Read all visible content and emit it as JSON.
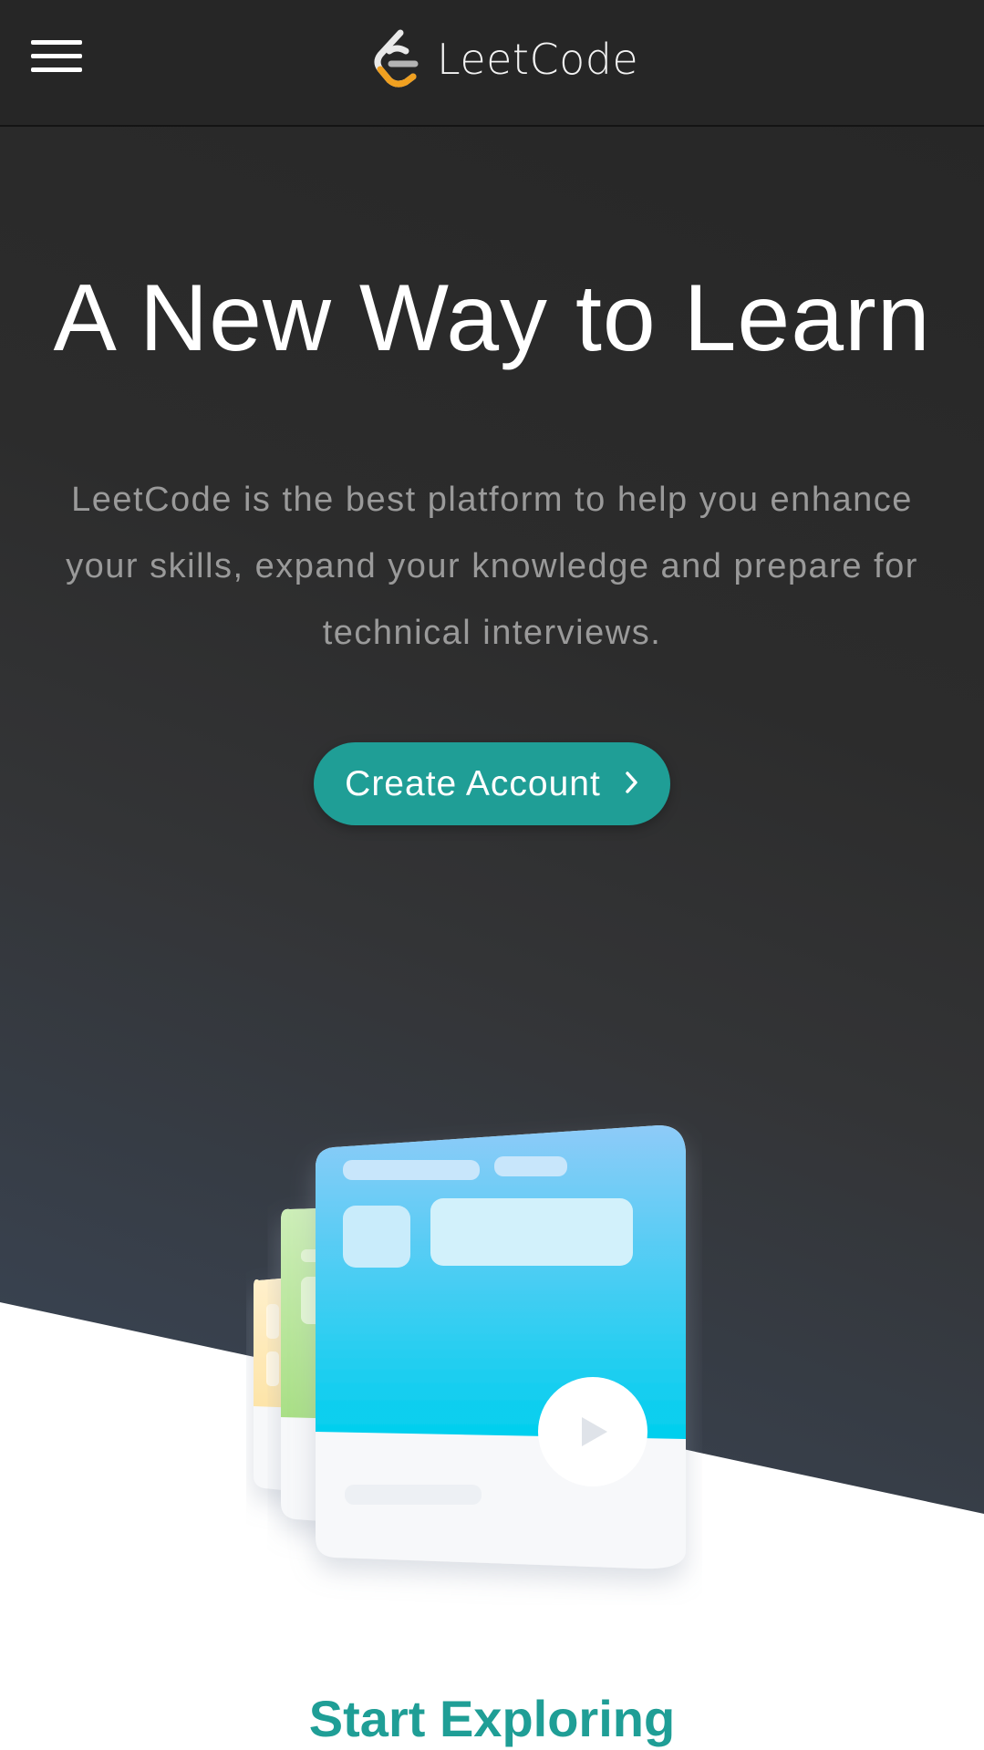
{
  "header": {
    "menu_icon": "hamburger-menu-icon",
    "logo_text": "LeetCode"
  },
  "hero": {
    "headline": "A New Way to Learn",
    "description": "LeetCode is the best platform to help you enhance your skills, expand your knowledge and prepare for technical interviews.",
    "cta_label": "Create Account",
    "cta_icon": "chevron-right-icon"
  },
  "explore": {
    "title": "Start Exploring"
  },
  "colors": {
    "header_bg": "#262626",
    "accent": "#1f9e96",
    "logo_orange": "#f0a020",
    "hero_text": "#ffffff",
    "hero_subtext": "#9a9a9a"
  }
}
